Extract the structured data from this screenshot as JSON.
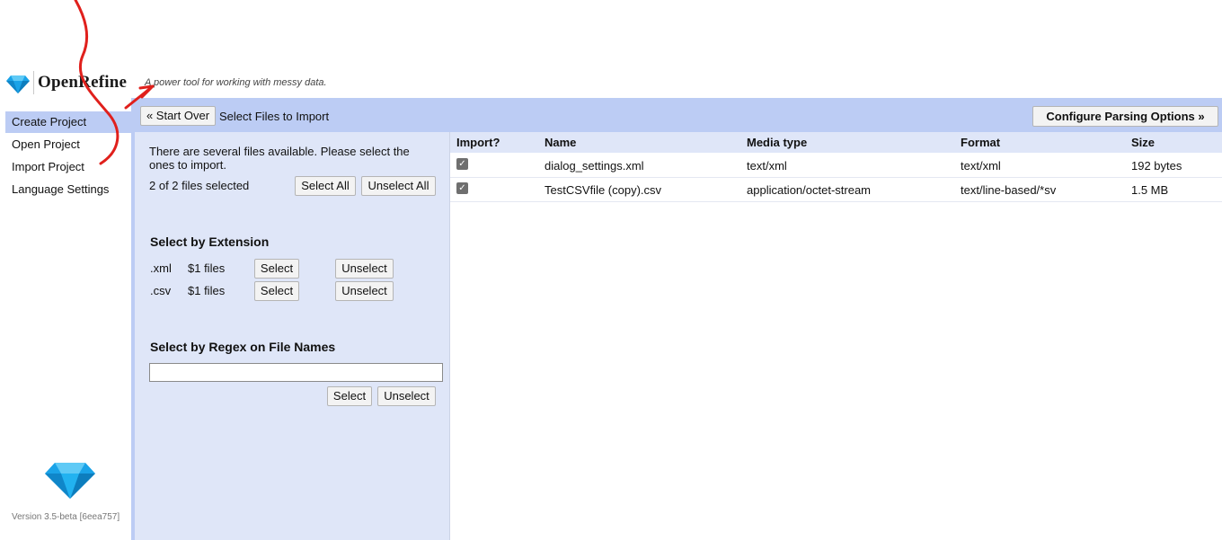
{
  "header": {
    "app_name": "OpenRefine",
    "tagline": "A power tool for working with messy data.",
    "logo_icon": "diamond-icon"
  },
  "sidebar": {
    "items": [
      {
        "label": "Create Project",
        "selected": true
      },
      {
        "label": "Open Project",
        "selected": false
      },
      {
        "label": "Import Project",
        "selected": false
      },
      {
        "label": "Language Settings",
        "selected": false
      }
    ],
    "version": "Version 3.5-beta [6eea757]"
  },
  "toolbar": {
    "start_over_label": "« Start Over",
    "title": "Select Files to Import",
    "configure_label": "Configure Parsing Options »"
  },
  "file_selection": {
    "message": "There are several files available. Please select the ones to import.",
    "selected_count": "2 of 2 files selected",
    "select_all_label": "Select All",
    "unselect_all_label": "Unselect All",
    "by_extension": {
      "title": "Select by Extension",
      "rows": [
        {
          "ext": ".xml",
          "count": "$1 files",
          "select_label": "Select",
          "unselect_label": "Unselect"
        },
        {
          "ext": ".csv",
          "count": "$1 files",
          "select_label": "Select",
          "unselect_label": "Unselect"
        }
      ]
    },
    "by_regex": {
      "title": "Select by Regex on File Names",
      "value": "",
      "select_label": "Select",
      "unselect_label": "Unselect"
    }
  },
  "files_table": {
    "columns": [
      "Import?",
      "Name",
      "Media type",
      "Format",
      "Size"
    ],
    "rows": [
      {
        "import": true,
        "name": "dialog_settings.xml",
        "media_type": "text/xml",
        "format": "text/xml",
        "size": "192 bytes"
      },
      {
        "import": true,
        "name": "TestCSVfile (copy).csv",
        "media_type": "application/octet-stream",
        "format": "text/line-based/*sv",
        "size": "1.5 MB"
      }
    ]
  },
  "colors": {
    "accent_panel": "#bcccf4",
    "light_panel": "#dfe6f8",
    "annotation_arrow": "#e0201c",
    "logo_blue": "#1aa3e8"
  }
}
